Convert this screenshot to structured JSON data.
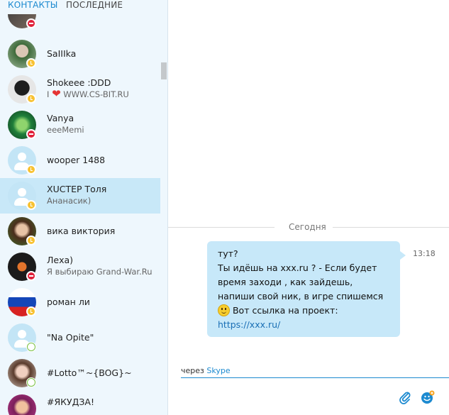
{
  "tabs": {
    "contacts": "КОНТАКТЫ",
    "recent": "ПОСЛЕДНИЕ"
  },
  "contacts": [
    {
      "name": "",
      "mood": "",
      "status": "dnd"
    },
    {
      "name": "SaIIIka",
      "mood": "",
      "status": "away"
    },
    {
      "name": "Shokeee :DDD",
      "mood_prefix": "I",
      "mood": "WWW.CS-BIT.RU",
      "status": "away"
    },
    {
      "name": "Vanya",
      "mood": "eeeMemi",
      "status": "dnd"
    },
    {
      "name": "wooper 1488",
      "mood": "",
      "status": "away"
    },
    {
      "name": "XUCTEP Толя",
      "mood": "Ананасик)",
      "status": "away",
      "selected": true
    },
    {
      "name": "вика виктория",
      "mood": "",
      "status": "away"
    },
    {
      "name": "Леха)",
      "mood": "Я выбираю Grand-War.Ru",
      "status": "dnd"
    },
    {
      "name": "роман ли",
      "mood": "",
      "status": "away"
    },
    {
      "name": "\"Na Opite\"",
      "mood": "",
      "status": "offline"
    },
    {
      "name": "#Lotto™~{BOG}~",
      "mood": "",
      "status": "offline"
    },
    {
      "name": "#ЯКУДЗА!",
      "mood": "",
      "status": "away"
    }
  ],
  "chat": {
    "date_divider": "Сегодня",
    "message": {
      "lines": [
        "тут?",
        "Ты идёшь на xxx.ru ? - Если будет",
        "время заходи , как зайдешь,",
        "напиши свой ник, в игре спишемся",
        "Вот ссылка на проект:"
      ],
      "link": "https://xxx.ru/",
      "time": "13:18"
    },
    "via_prefix": "через",
    "via_brand": "Skype"
  },
  "colors": {
    "accent": "#1c8ad0",
    "bubble": "#c7e8f9",
    "selected": "#c8e8f8",
    "away": "#f8c232",
    "dnd": "#e0213a",
    "offline": "#7ac143"
  },
  "icons": [
    "paperclip-icon",
    "emoticon-icon",
    "heart-icon",
    "smiley-icon"
  ]
}
